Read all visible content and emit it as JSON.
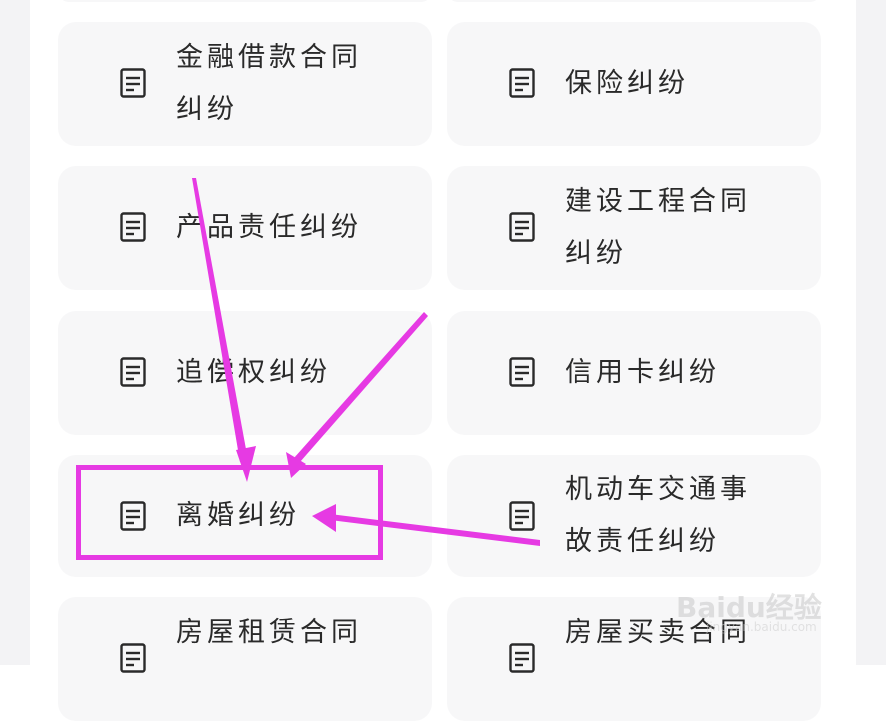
{
  "categories": [
    {
      "lines": [
        "金融借款合同",
        "纠纷"
      ],
      "icon": "document-icon"
    },
    {
      "lines": [
        "保险纠纷"
      ],
      "icon": "document-icon"
    },
    {
      "lines": [
        "产品责任纠纷"
      ],
      "icon": "document-icon"
    },
    {
      "lines": [
        "建设工程合同",
        "纠纷"
      ],
      "icon": "document-icon"
    },
    {
      "lines": [
        "追偿权纠纷"
      ],
      "icon": "document-icon"
    },
    {
      "lines": [
        "信用卡纠纷"
      ],
      "icon": "document-icon"
    },
    {
      "lines": [
        "离婚纠纷"
      ],
      "icon": "document-icon"
    },
    {
      "lines": [
        "机动车交通事",
        "故责任纠纷"
      ],
      "icon": "document-icon"
    },
    {
      "lines": [
        "房屋租赁合同"
      ],
      "icon": "document-icon"
    },
    {
      "lines": [
        "房屋买卖合同"
      ],
      "icon": "document-icon"
    }
  ],
  "annotation": {
    "highlight_color": "#e63ae3",
    "highlighted_item": "离婚纠纷"
  },
  "watermark": {
    "brand": "Baidu经验",
    "url": "jingyan.baidu.com"
  },
  "colors": {
    "card_bg": "#f7f7f8",
    "text": "#2a2a2a",
    "accent": "#e63ae3"
  }
}
